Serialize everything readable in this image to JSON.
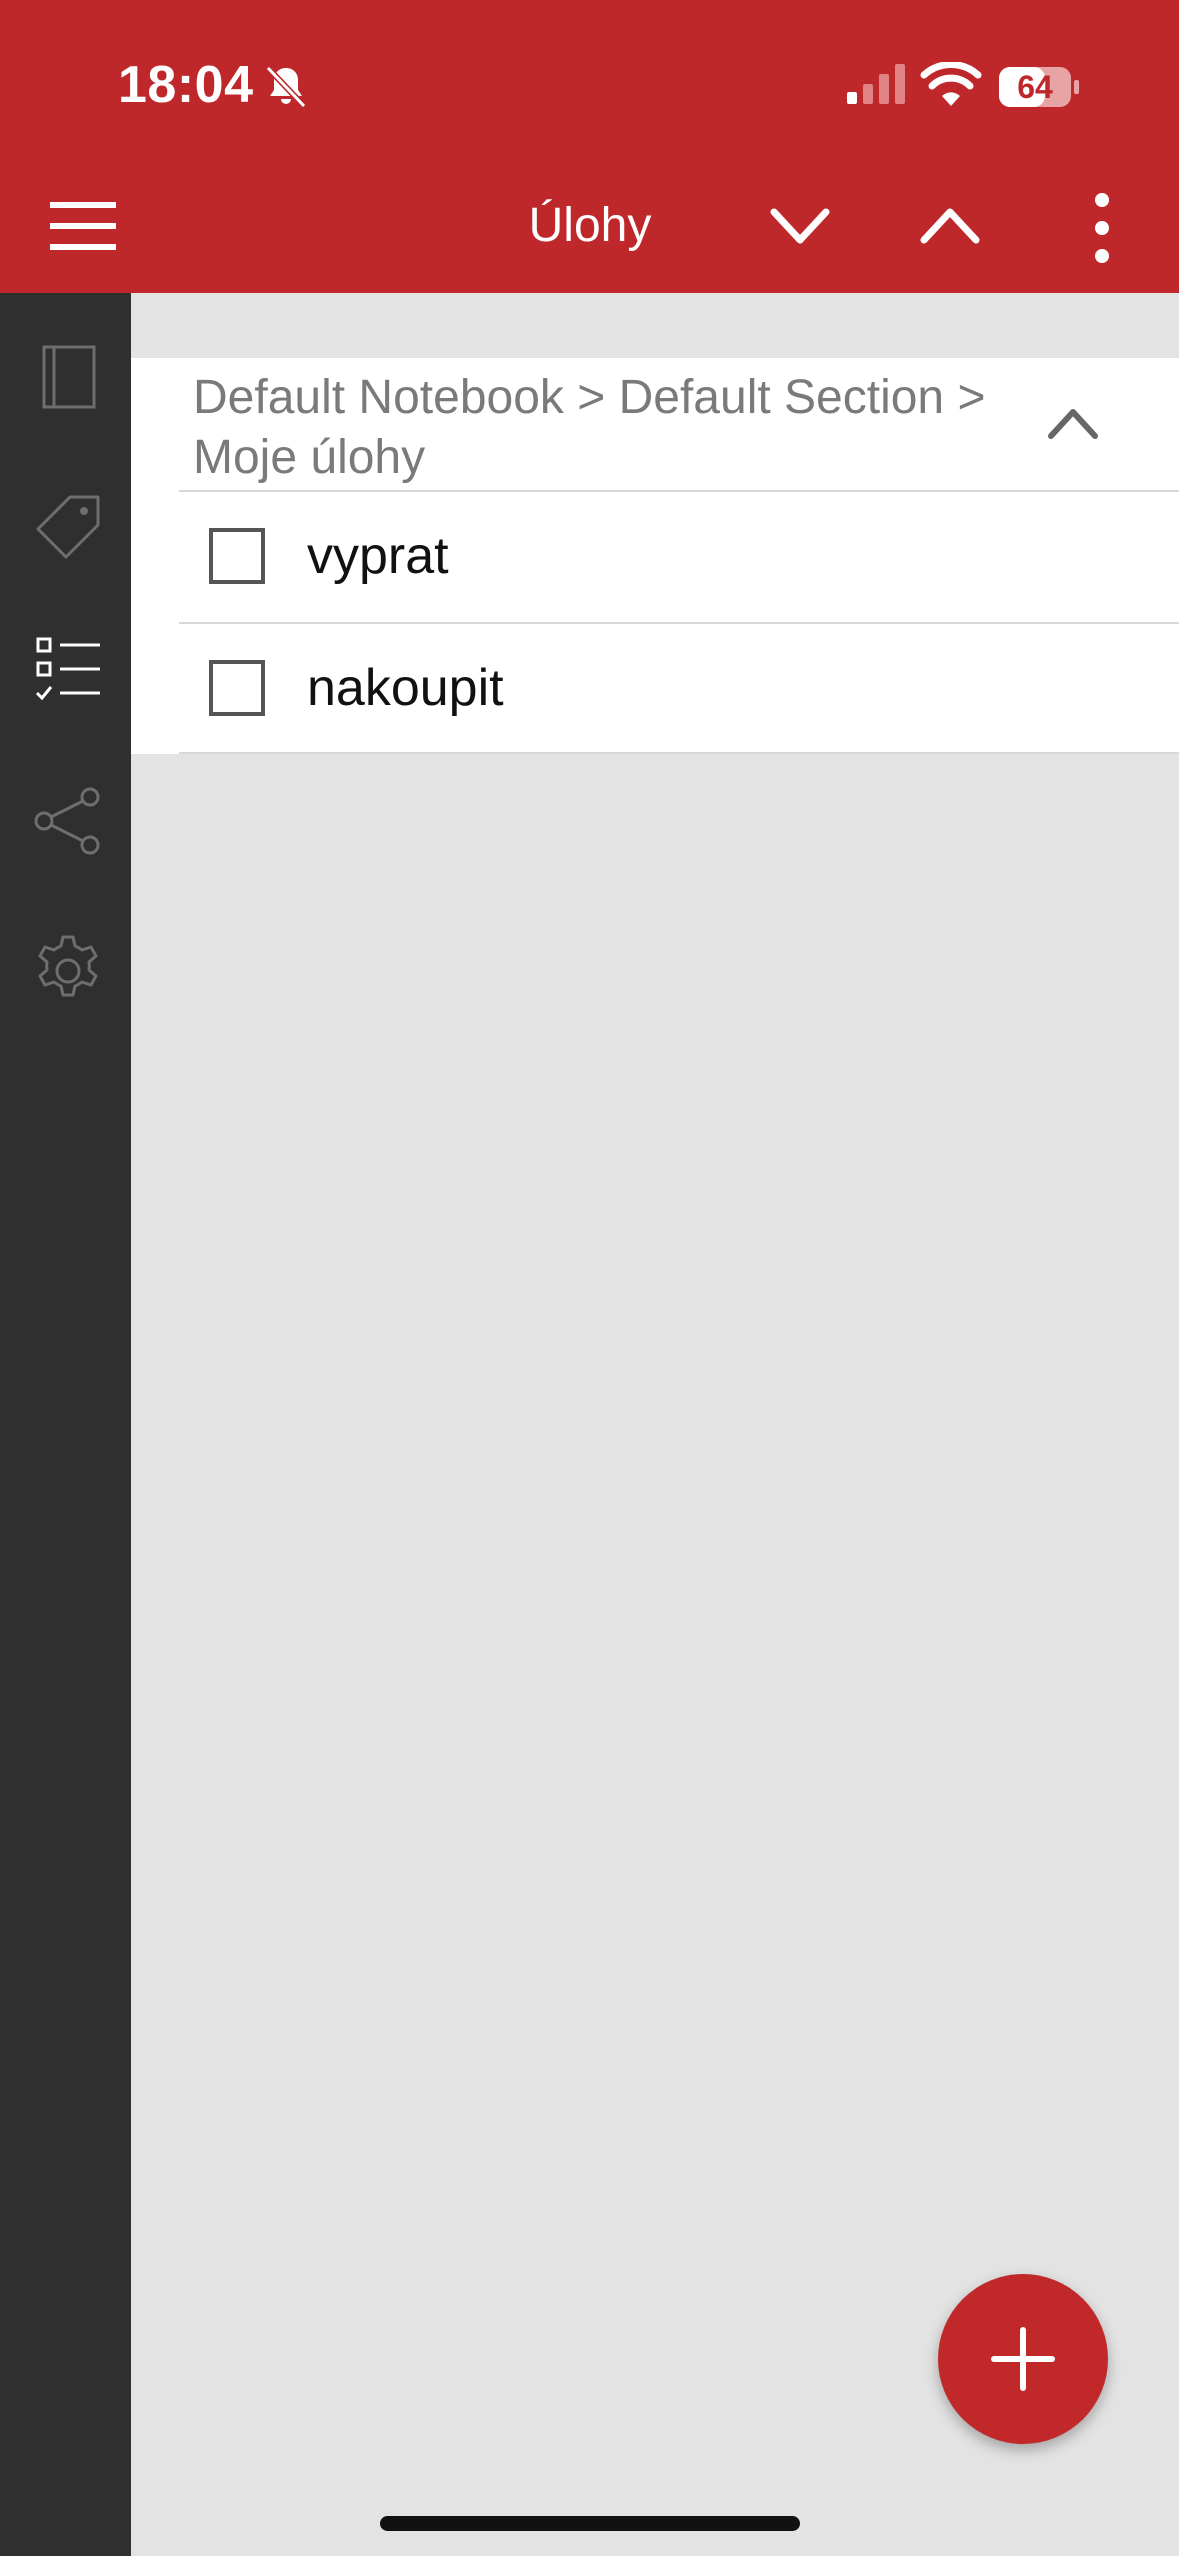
{
  "status_bar": {
    "time": "18:04",
    "battery": "64"
  },
  "app_bar": {
    "title": "Úlohy"
  },
  "breadcrumb": {
    "text": "Default Notebook > Default Section > Moje úlohy"
  },
  "tasks": [
    {
      "label": "vyprat",
      "checked": false
    },
    {
      "label": "nakoupit",
      "checked": false
    }
  ],
  "colors": {
    "accent": "#bf282a",
    "sidebar": "#2f2f2f",
    "background": "#e3e3e3",
    "card": "#ffffff",
    "breadcrumb_text": "#7a7a7a"
  },
  "icons": {
    "menu": "hamburger-icon",
    "nav_down": "chevron-down-icon",
    "nav_up": "chevron-up-icon",
    "more": "more-vertical-icon",
    "notebook": "notebook-icon",
    "tag": "tag-icon",
    "tasks": "checklist-icon",
    "share": "share-icon",
    "settings": "gear-icon",
    "collapse": "chevron-up-icon",
    "add": "plus-icon"
  }
}
